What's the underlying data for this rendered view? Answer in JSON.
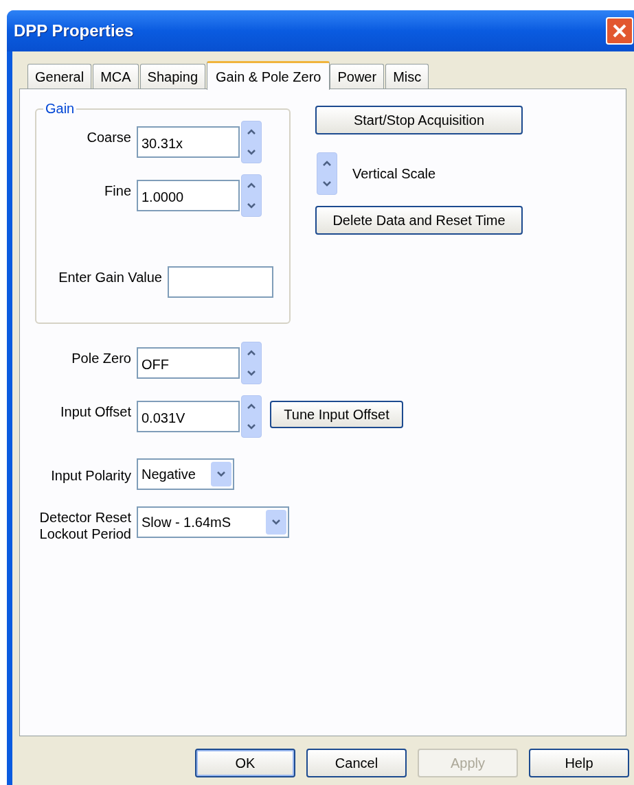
{
  "window": {
    "title": "DPP Properties"
  },
  "tabs": [
    {
      "label": "General",
      "selected": false
    },
    {
      "label": "MCA",
      "selected": false
    },
    {
      "label": "Shaping",
      "selected": false
    },
    {
      "label": "Gain & Pole Zero",
      "selected": true
    },
    {
      "label": "Power",
      "selected": false
    },
    {
      "label": "Misc",
      "selected": false
    }
  ],
  "gain_group": {
    "title": "Gain",
    "coarse": {
      "label": "Coarse",
      "value": "30.31x"
    },
    "fine": {
      "label": "Fine",
      "value": "1.0000"
    },
    "enter_gain_value": {
      "label": "Enter Gain Value"
    }
  },
  "pole_zero": {
    "label": "Pole Zero",
    "value": "OFF"
  },
  "input_offset": {
    "label": "Input Offset",
    "value": "0.031V",
    "button": "Tune Input Offset"
  },
  "input_polarity": {
    "label": "Input Polarity",
    "value": "Negative"
  },
  "detector_reset_lockout_period": {
    "label": "Detector Reset Lockout Period",
    "value": "Slow - 1.64mS"
  },
  "acquisition": {
    "start_stop_button": "Start/Stop Acquisition",
    "vertical_scale_label": "Vertical Scale",
    "delete_button": "Delete Data and Reset Time"
  },
  "buttons": [
    {
      "label": "OK",
      "default": true,
      "disabled": false
    },
    {
      "label": "Cancel",
      "default": false,
      "disabled": false
    },
    {
      "label": "Apply",
      "default": false,
      "disabled": true
    },
    {
      "label": "Help",
      "default": false,
      "disabled": false
    }
  ]
}
